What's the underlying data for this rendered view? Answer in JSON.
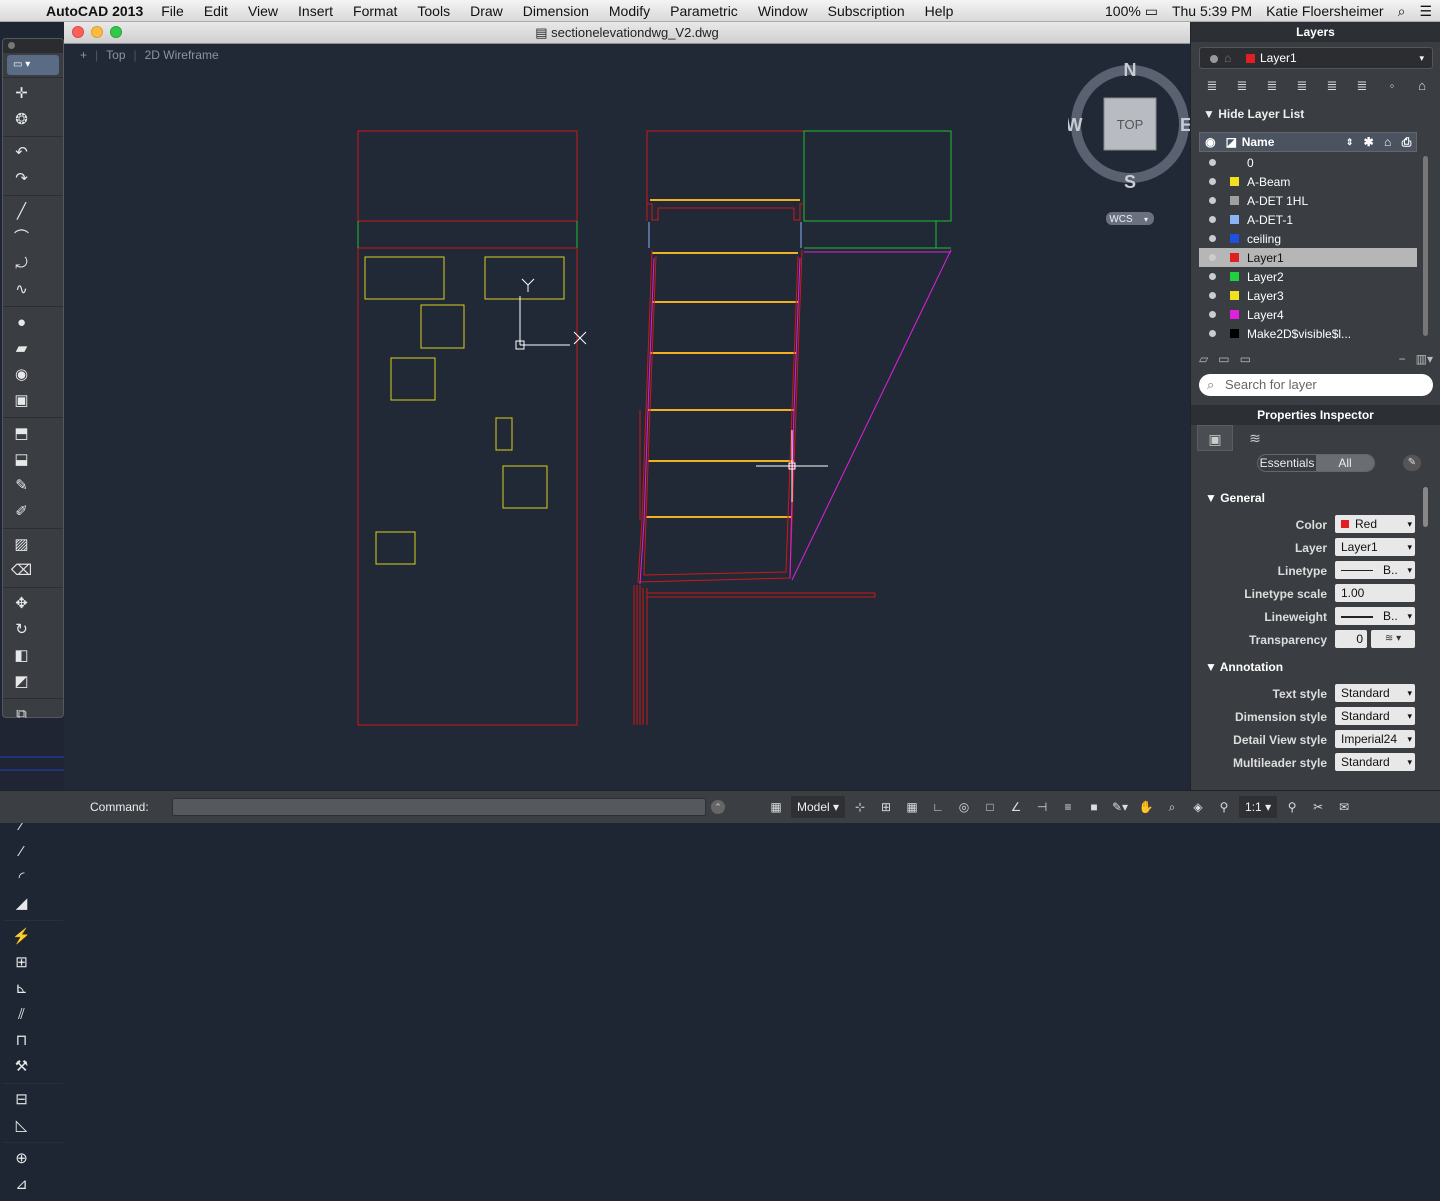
{
  "menubar": {
    "app": "AutoCAD 2013",
    "items": [
      "File",
      "Edit",
      "View",
      "Insert",
      "Format",
      "Tools",
      "Draw",
      "Dimension",
      "Modify",
      "Parametric",
      "Window",
      "Subscription",
      "Help"
    ],
    "battery": "100%",
    "clock": "Thu 5:39 PM",
    "user": "Katie Floersheimer"
  },
  "window": {
    "title": "sectionelevationdwg_V2.dwg"
  },
  "viewport": {
    "plus": "+",
    "view": "Top",
    "style": "2D Wireframe"
  },
  "viewcube": {
    "north": "N",
    "south": "S",
    "east": "E",
    "west": "W",
    "face": "TOP",
    "ucs": "WCS"
  },
  "ucs_icon": {
    "x": "X",
    "y": "Y"
  },
  "command": {
    "label": "Command:"
  },
  "status": {
    "model": "Model",
    "scale": "1:1"
  },
  "layers_panel": {
    "title": "Layers",
    "current": "Layer1",
    "current_color": "#e02020",
    "hide_list": "Hide Layer List",
    "header_name": "Name",
    "rows": [
      {
        "name": "0",
        "color": ""
      },
      {
        "name": "A-Beam",
        "color": "#f0e020"
      },
      {
        "name": "A-DET 1HL",
        "color": "#a0a0a0"
      },
      {
        "name": "A-DET-1",
        "color": "#8ab4f8"
      },
      {
        "name": "ceiling",
        "color": "#2050e0"
      },
      {
        "name": "Layer1",
        "color": "#e02020"
      },
      {
        "name": "Layer2",
        "color": "#20d040"
      },
      {
        "name": "Layer3",
        "color": "#f0e020"
      },
      {
        "name": "Layer4",
        "color": "#e020e0"
      },
      {
        "name": "Make2D$visible$l...",
        "color": "#000000"
      }
    ],
    "search_placeholder": "Search for layer"
  },
  "properties": {
    "title": "Properties Inspector",
    "seg_essentials": "Essentials",
    "seg_all": "All",
    "general": "General",
    "annotation": "Annotation",
    "color_label": "Color",
    "color_value": "Red",
    "layer_label": "Layer",
    "layer_value": "Layer1",
    "linetype_label": "Linetype",
    "linetype_value": "B..",
    "ltscale_label": "Linetype scale",
    "ltscale_value": "1.00",
    "lineweight_label": "Lineweight",
    "lineweight_value": "B..",
    "transparency_label": "Transparency",
    "transparency_value": "0",
    "textstyle_label": "Text style",
    "textstyle_value": "Standard",
    "dimstyle_label": "Dimension style",
    "dimstyle_value": "Standard",
    "detailstyle_label": "Detail View style",
    "detailstyle_value": "Imperial24",
    "mleader_label": "Multileader style",
    "mleader_value": "Standard"
  }
}
